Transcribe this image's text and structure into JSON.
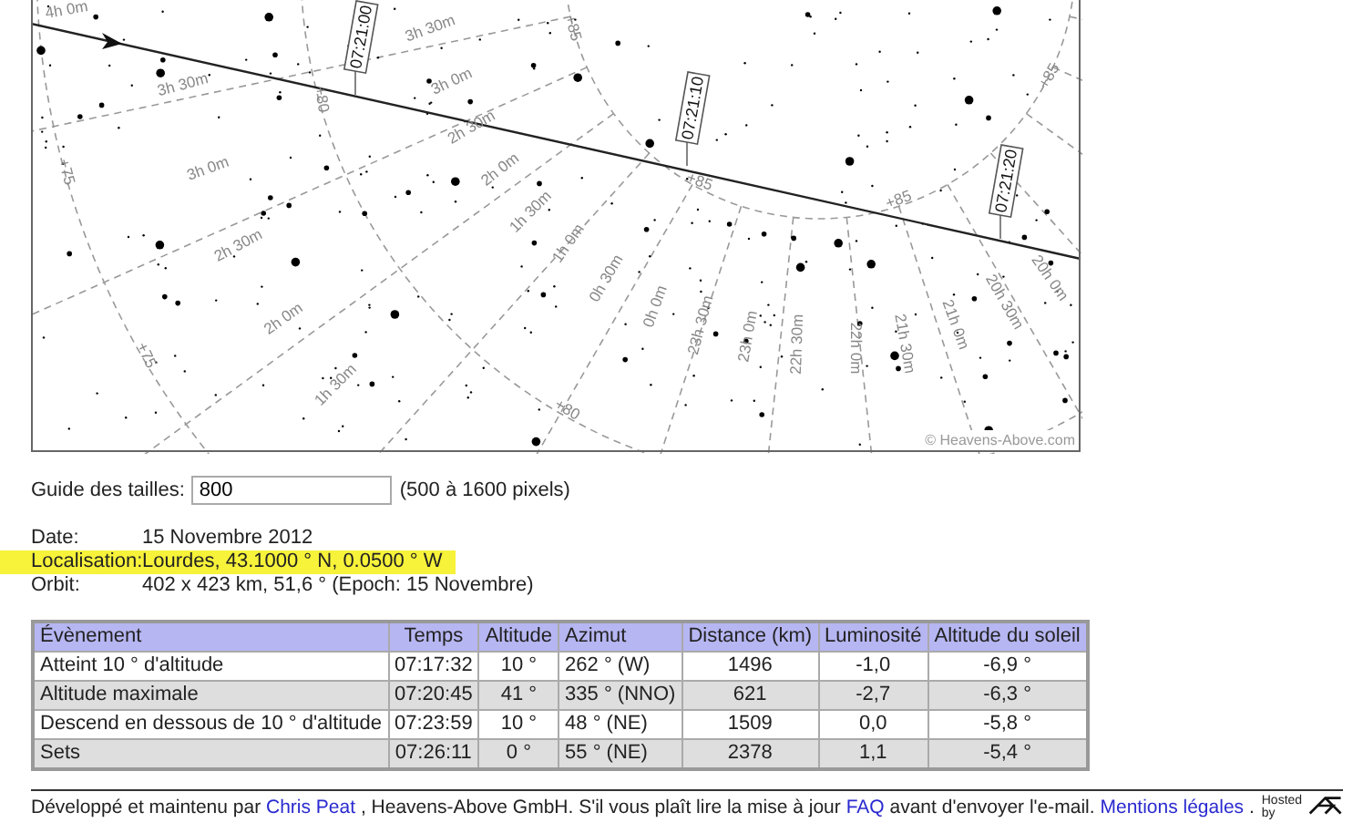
{
  "chart": {
    "time_labels": [
      "07:21:00",
      "07:21:10",
      "07:21:20"
    ],
    "ra_labels": [
      "4h 0m",
      "3h 30m",
      "3h 30m",
      "3h 0m",
      "3h 0m",
      "2h 30m",
      "2h 0m",
      "2h 30m",
      "1h 30m",
      "1h 0m",
      "2h 0m",
      "0h 30m",
      "0h 0m",
      "23h 30m",
      "1h 30m",
      "23h 0m",
      "22h 30m",
      "22h 0m",
      "21h 30m",
      "21h 0m",
      "20h 30m",
      "20h 0m"
    ],
    "dec_labels": [
      "+85",
      "+80",
      "+75",
      "+75",
      "+80",
      "+85",
      "+85",
      "+85"
    ],
    "credit": "© Heavens-Above.com"
  },
  "size_field": {
    "label": "Guide des tailles:",
    "value": "800",
    "hint": "(500 à 1600 pixels)"
  },
  "info": [
    {
      "label": "Date:",
      "value": "15 Novembre 2012",
      "highlighted": false
    },
    {
      "label": "Localisation:",
      "value": "Lourdes, 43.1000 ° N, 0.0500 ° W",
      "highlighted": true
    },
    {
      "label": "Orbit:",
      "value": "402 x 423 km, 51,6 ° (Epoch: 15 Novembre)",
      "highlighted": false
    }
  ],
  "table": {
    "columns": [
      "Évènement",
      "Temps",
      "Altitude",
      "Azimut",
      "Distance (km)",
      "Luminosité",
      "Altitude du soleil"
    ],
    "rows": [
      [
        "Atteint 10 ° d'altitude",
        "07:17:32",
        "10 °",
        "262 ° (W)",
        "1496",
        "-1,0",
        "-6,9 °"
      ],
      [
        "Altitude maximale",
        "07:20:45",
        "41 °",
        "335 ° (NNO)",
        "621",
        "-2,7",
        "-6,3 °"
      ],
      [
        "Descend en dessous de 10 ° d'altitude",
        "07:23:59",
        "10 °",
        "48 ° (NE)",
        "1509",
        "0,0",
        "-5,8 °"
      ],
      [
        "Sets",
        "07:26:11",
        "0 °",
        "55 ° (NE)",
        "2378",
        "1,1",
        "-5,4 °"
      ]
    ]
  },
  "footer": {
    "parts": [
      {
        "kind": "text",
        "text": "Développé et maintenu par "
      },
      {
        "kind": "link",
        "text": "Chris Peat"
      },
      {
        "kind": "text",
        "text": " , Heavens-Above GmbH. S'il vous plaît lire la mise à jour "
      },
      {
        "kind": "link",
        "text": "FAQ"
      },
      {
        "kind": "text",
        "text": " avant d'envoyer l'e-mail. "
      },
      {
        "kind": "link",
        "text": "Mentions légales"
      },
      {
        "kind": "text",
        "text": " ."
      }
    ],
    "hosted_label": "Hosted by"
  }
}
